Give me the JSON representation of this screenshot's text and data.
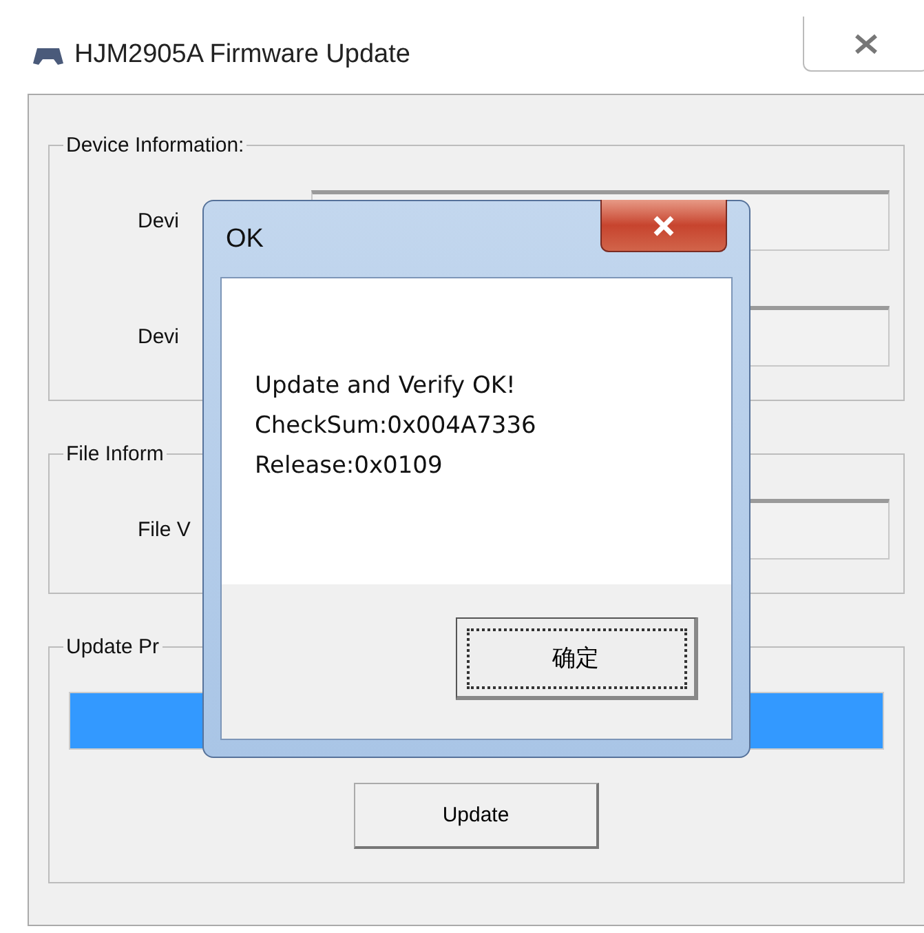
{
  "window": {
    "title": "HJM2905A Firmware Update"
  },
  "groups": [
    {
      "kind": "fields",
      "label": "Device Information:",
      "rows": [
        {
          "label": "Devi"
        },
        {
          "label": "Devi"
        }
      ]
    },
    {
      "kind": "fields",
      "label": "File Inform",
      "rows": [
        {
          "label": "File V"
        }
      ]
    },
    {
      "kind": "progress",
      "label": "Update Pr",
      "progress": {
        "level": 1
      },
      "button": "Update"
    }
  ],
  "dialog": {
    "title": "OK",
    "message": [
      "Update and Verify OK!",
      "CheckSum:0x004A7336",
      "Release:0x0109"
    ],
    "button": "确定"
  }
}
